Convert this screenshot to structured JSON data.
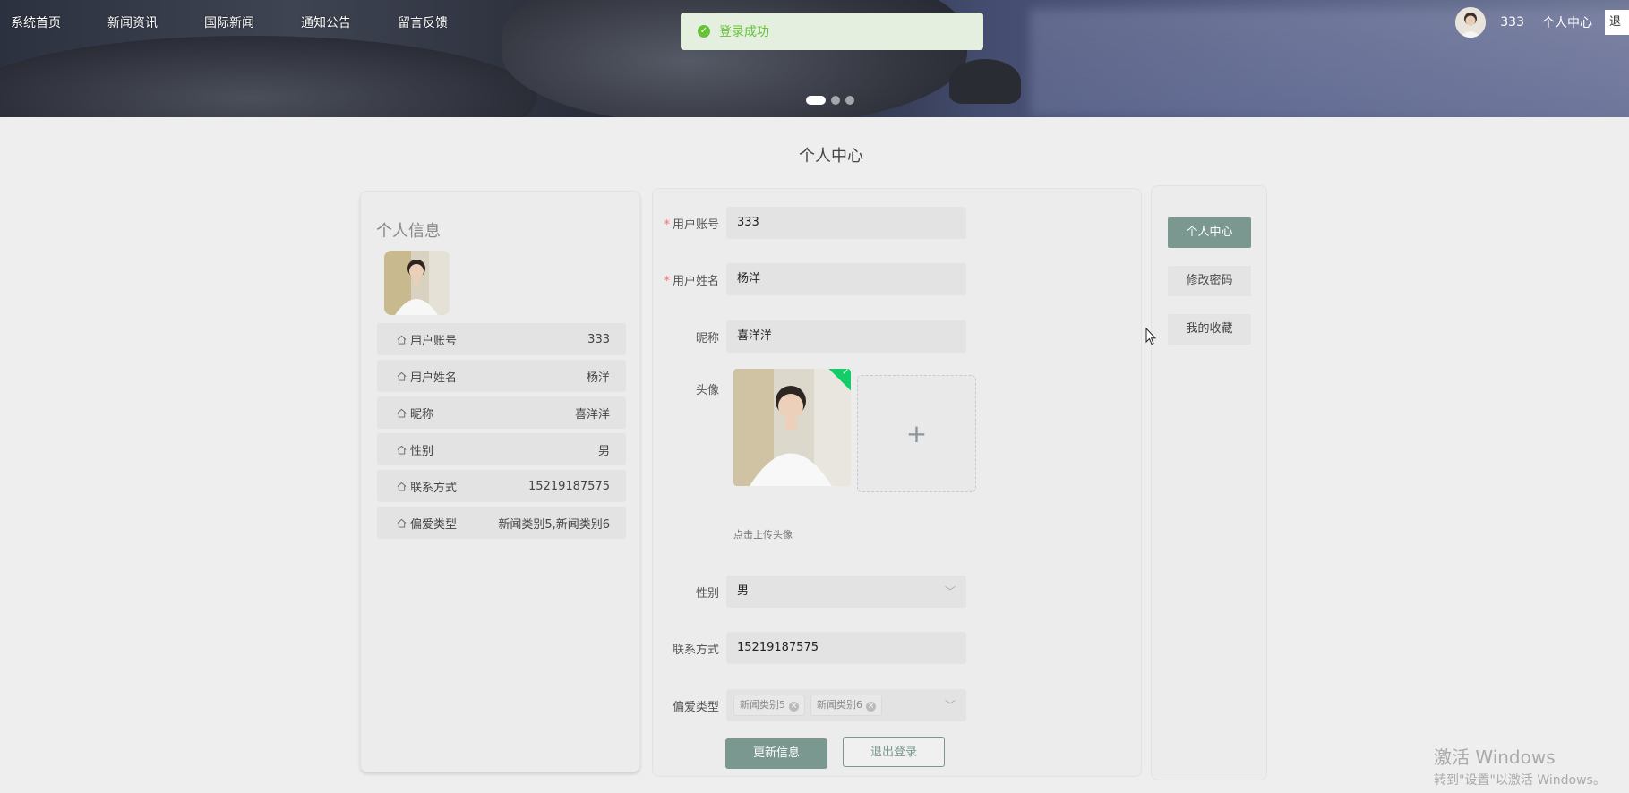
{
  "nav": {
    "items": [
      "系统首页",
      "新闻资讯",
      "国际新闻",
      "通知公告",
      "留言反馈"
    ]
  },
  "user": {
    "name": "333",
    "center_label": "个人中心",
    "logout_partial": "退"
  },
  "toast": {
    "message": "登录成功"
  },
  "carousel": {
    "slides": 3,
    "active": 1
  },
  "page": {
    "title": "个人中心"
  },
  "left_panel": {
    "title": "个人信息",
    "rows": [
      {
        "label": "用户账号",
        "value": "333"
      },
      {
        "label": "用户姓名",
        "value": "杨洋"
      },
      {
        "label": "昵称",
        "value": "喜洋洋"
      },
      {
        "label": "性别",
        "value": "男"
      },
      {
        "label": "联系方式",
        "value": "15219187575"
      },
      {
        "label": "偏爱类型",
        "value": "新闻类别5,新闻类别6"
      }
    ]
  },
  "form": {
    "account_label": "用户账号",
    "account_value": "333",
    "name_label": "用户姓名",
    "name_value": "杨洋",
    "nickname_label": "昵称",
    "nickname_value": "喜洋洋",
    "avatar_label": "头像",
    "upload_tip": "点击上传头像",
    "gender_label": "性别",
    "gender_value": "男",
    "phone_label": "联系方式",
    "phone_value": "15219187575",
    "pref_label": "偏爱类型",
    "pref_tags": [
      "新闻类别5",
      "新闻类别6"
    ],
    "update_button": "更新信息",
    "logout_button": "退出登录"
  },
  "side_menu": {
    "items": [
      "个人中心",
      "修改密码",
      "我的收藏"
    ],
    "active_index": 0
  },
  "watermark": {
    "line1": "激活 Windows",
    "line2": "转到\"设置\"以激活 Windows。"
  },
  "colors": {
    "accent": "#7a9890",
    "success": "#67c23a",
    "required": "#f56c6c"
  }
}
